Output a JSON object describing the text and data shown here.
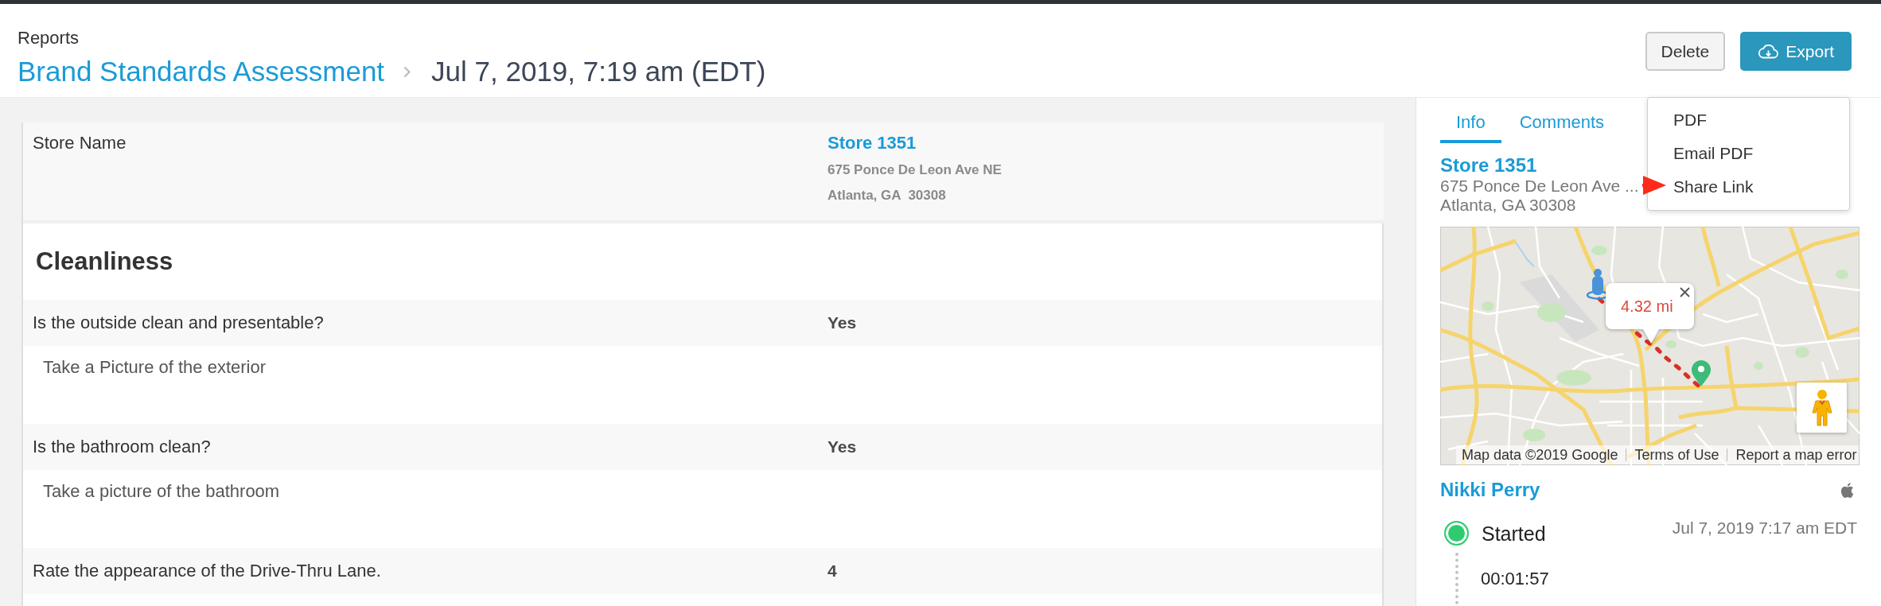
{
  "header": {
    "breadcrumb": "Reports",
    "report_link": "Brand Standards Assessment",
    "timestamp": "Jul 7, 2019, 7:19 am (EDT)",
    "delete_button": "Delete",
    "export_button": {
      "label": "Export",
      "menu_items": [
        "PDF",
        "Email PDF",
        "Share Link"
      ]
    }
  },
  "report": {
    "store_field": {
      "label": "Store Name",
      "store": "Store 1351",
      "address_lines": [
        "675 Ponce De Leon Ave NE",
        "Atlanta, GA  30308"
      ]
    },
    "sections": [
      {
        "title": "Cleanliness",
        "rows": [
          {
            "kind": "question",
            "question": "Is the outside clean and presentable?",
            "answer": "Yes"
          },
          {
            "kind": "photo",
            "prompt": "Take a Picture of the exterior"
          },
          {
            "kind": "question",
            "question": "Is the bathroom clean?",
            "answer": "Yes"
          },
          {
            "kind": "photo",
            "prompt": "Take a picture of the bathroom"
          },
          {
            "kind": "question",
            "question": "Rate the appearance of the Drive-Thru Lane.",
            "answer": "4"
          }
        ]
      }
    ]
  },
  "side_panel": {
    "tabs": [
      {
        "label": "Info",
        "selected": true
      },
      {
        "label": "Comments",
        "selected": false
      }
    ],
    "store": {
      "name": "Store 1351",
      "address_lines": [
        "675 Ponce De Leon Ave ...",
        "Atlanta, GA 30308"
      ]
    },
    "map": {
      "distance": "4.32 mi",
      "attribution": "Map data ©2019 Google",
      "terms_link": "Terms of Use",
      "report_link": "Report a map error"
    },
    "user": {
      "name": "Nikki Perry"
    },
    "timeline": [
      {
        "status": "Started",
        "time": "Jul 7, 2019 7:17 am EDT",
        "color": "#2ecc71",
        "duration": "00:01:57"
      }
    ]
  }
}
